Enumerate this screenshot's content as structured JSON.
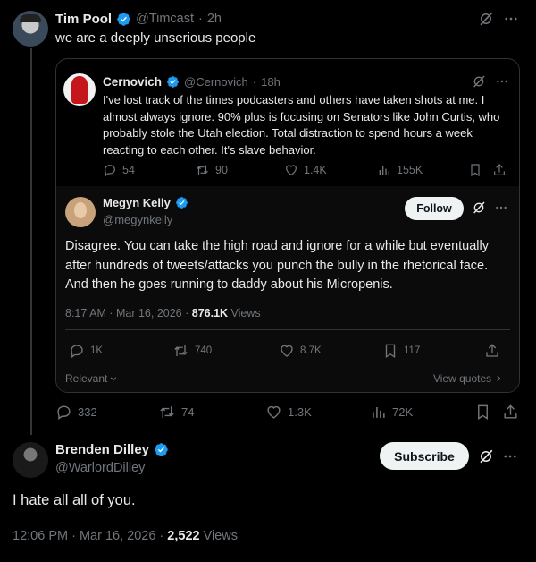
{
  "main_post": {
    "name": "Tim Pool",
    "handle": "@Timcast",
    "time": "2h",
    "text": "we are a deeply unserious people",
    "stats": {
      "replies": "332",
      "reposts": "74",
      "likes": "1.3K",
      "views": "72K"
    }
  },
  "quoted_post": {
    "name": "Cernovich",
    "handle": "@Cernovich",
    "time": "18h",
    "text": "I've lost track of the times podcasters and others have taken shots at me. I almost always ignore. 90% plus is focusing on Senators like John Curtis, who probably stole the Utah election. Total distraction to spend hours a week reacting to each other. It's slave behavior.",
    "stats": {
      "replies": "54",
      "reposts": "90",
      "likes": "1.4K",
      "views": "155K"
    }
  },
  "inner_post": {
    "name": "Megyn Kelly",
    "handle": "@megynkelly",
    "follow_label": "Follow",
    "text": "Disagree. You can take the high road and ignore for a while but eventually after hundreds of tweets/attacks you punch the bully in the rhetorical face. And then he goes running to daddy about his Micropenis.",
    "timestamp": "8:17 AM · Mar 16, 2026 · ",
    "views_count": "876.1K",
    "views_label": " Views",
    "stats": {
      "replies": "1K",
      "reposts": "740",
      "likes": "8.7K",
      "bookmarks": "117"
    },
    "relevant_label": "Relevant",
    "view_quotes_label": "View quotes"
  },
  "reply_post": {
    "name": "Brenden Dilley",
    "handle": "@WarlordDilley",
    "subscribe_label": "Subscribe",
    "text": "I hate all all of you.",
    "timestamp": "12:06 PM · Mar 16, 2026 · ",
    "views_count": "2,522",
    "views_label": " Views"
  },
  "colors": {
    "verified": "#1d9bf0",
    "background": "#000000",
    "muted": "#71767b",
    "border": "#2f3336"
  },
  "icons": [
    "verified-badge-icon",
    "grok-icon",
    "more-icon",
    "reply-icon",
    "repost-icon",
    "like-icon",
    "views-icon",
    "bookmark-icon",
    "share-icon",
    "chevron-down-icon",
    "chevron-right-icon"
  ]
}
